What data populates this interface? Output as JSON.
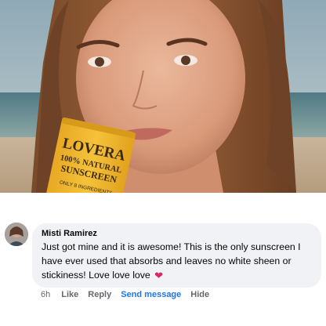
{
  "post_image": {
    "description_icon": "photo-woman-sunscreen",
    "product": {
      "brand": "LOVERA",
      "line1": "100% NATURAL",
      "line2": "SUNSCREEN",
      "line3": "ONLY 8 INGREDIENTS"
    }
  },
  "comment": {
    "author": "Misti Ramirez",
    "text": "Just got mine and it is awesome! This is the only sunscreen I have ever used that absorbs and leaves no white sheen or stickiness! Love love love",
    "emoji": "❤",
    "actions": {
      "time": "6h",
      "like": "Like",
      "reply": "Reply",
      "send_message": "Send message",
      "hide": "Hide"
    }
  },
  "colors": {
    "tube_yellow": "#f2b92e",
    "link_blue": "#1877f2",
    "bubble_bg": "#f0f2f5",
    "meta_gray": "#65676b"
  }
}
